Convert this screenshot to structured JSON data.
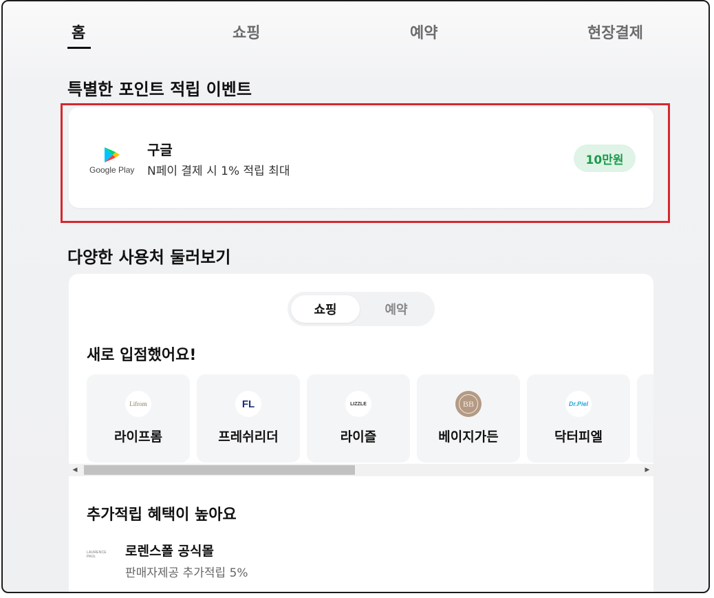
{
  "tabs": [
    {
      "label": "홈",
      "active": true
    },
    {
      "label": "쇼핑",
      "active": false
    },
    {
      "label": "예약",
      "active": false
    },
    {
      "label": "현장결제",
      "active": false
    }
  ],
  "event_section": {
    "title": "특별한 포인트 적립 이벤트",
    "card": {
      "logo_text": "Google Play",
      "name": "구글",
      "description": "N페이 결제 시 1% 적립 최대",
      "badge": "10만원",
      "badge_color": "#1b9a4a"
    }
  },
  "places_section": {
    "title": "다양한 사용처 둘러보기",
    "segments": [
      {
        "label": "쇼핑",
        "active": true
      },
      {
        "label": "예약",
        "active": false
      }
    ],
    "new_title": "새로 입점했어요!",
    "stores": [
      {
        "name": "라이프롬",
        "logo_text": "Lifrom"
      },
      {
        "name": "프레쉬리더",
        "logo_text": "FL"
      },
      {
        "name": "라이즐",
        "logo_text": "LIZZLE"
      },
      {
        "name": "베이지가든",
        "logo_text": "BB"
      },
      {
        "name": "닥터피엘",
        "logo_text": "Dr.Piel"
      }
    ],
    "benefit_title": "추가적립 혜택이 높아요",
    "benefit_item": {
      "logo_text": "LAURENCE PAUL",
      "name": "로렌스폴 공식몰",
      "description": "판매자제공 추가적립 5%"
    }
  },
  "colors": {
    "highlight_border": "#d7262e",
    "badge_bg": "#dff3e6"
  }
}
